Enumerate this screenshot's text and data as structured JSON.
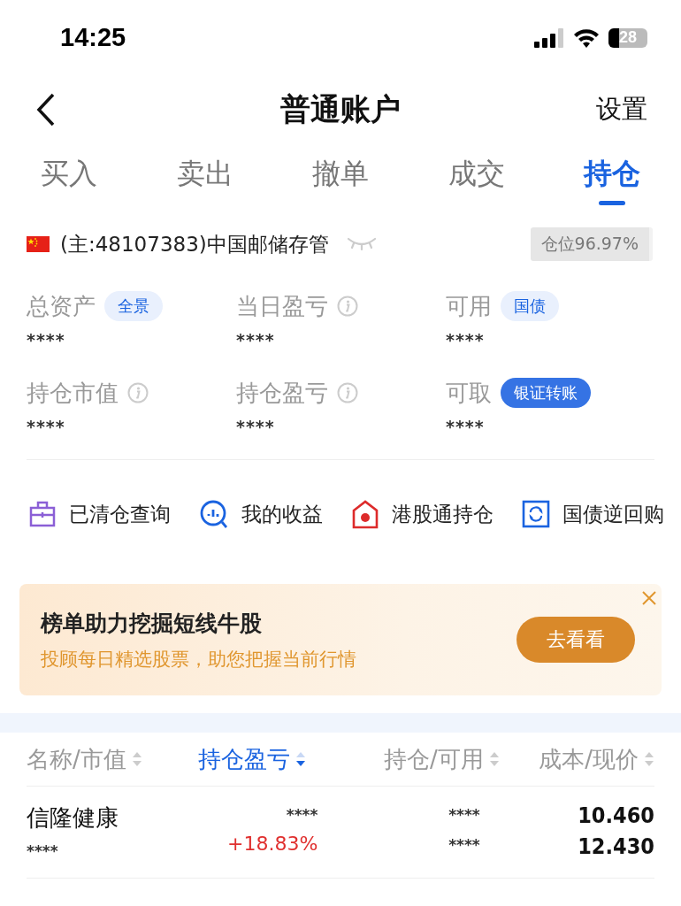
{
  "status_bar": {
    "time": "14:25",
    "battery": "28"
  },
  "header": {
    "title": "普通账户",
    "action": "设置"
  },
  "tabs": [
    {
      "label": "买入",
      "selected": false
    },
    {
      "label": "卖出",
      "selected": false
    },
    {
      "label": "撤单",
      "selected": false
    },
    {
      "label": "成交",
      "selected": false
    },
    {
      "label": "持仓",
      "selected": true
    }
  ],
  "account": {
    "name": "(主:48107383)中国邮储存管",
    "position": "仓位96.97%"
  },
  "metrics": [
    {
      "label": "总资产",
      "value": "****",
      "info": false,
      "badge": {
        "text": "全景",
        "kind": "soft"
      }
    },
    {
      "label": "当日盈亏",
      "value": "****",
      "info": true
    },
    {
      "label": "可用",
      "value": "****",
      "info": false,
      "badge": {
        "text": "国债",
        "kind": "soft"
      }
    },
    {
      "label": "持仓市值",
      "value": "****",
      "info": true
    },
    {
      "label": "持仓盈亏",
      "value": "****",
      "info": true
    },
    {
      "label": "可取",
      "value": "****",
      "info": false,
      "badge": {
        "text": "银证转账",
        "kind": "solid"
      }
    }
  ],
  "shortcuts": [
    {
      "label": "已清仓查询",
      "kind": "cleared"
    },
    {
      "label": "我的收益",
      "kind": "earnings"
    },
    {
      "label": "港股通持仓",
      "kind": "hk"
    },
    {
      "label": "国债逆回购",
      "kind": "repo"
    }
  ],
  "banner": {
    "title": "榜单助力挖掘短线牛股",
    "subtitle": "投顾每日精选股票，助您把握当前行情",
    "button": "去看看",
    "closable": true
  },
  "table": {
    "columns": [
      {
        "label": "名称/市值",
        "selected": false
      },
      {
        "label": "持仓盈亏",
        "selected": true
      },
      {
        "label": "持仓/可用",
        "selected": false
      },
      {
        "label": "成本/现价",
        "selected": false
      }
    ],
    "rows": [
      {
        "name": "信隆健康",
        "market_value": "****",
        "pnl": "****",
        "pnl_pct": "+18.83%",
        "holding": "****",
        "available": "****",
        "cost": "10.460",
        "price": "12.430"
      }
    ]
  }
}
